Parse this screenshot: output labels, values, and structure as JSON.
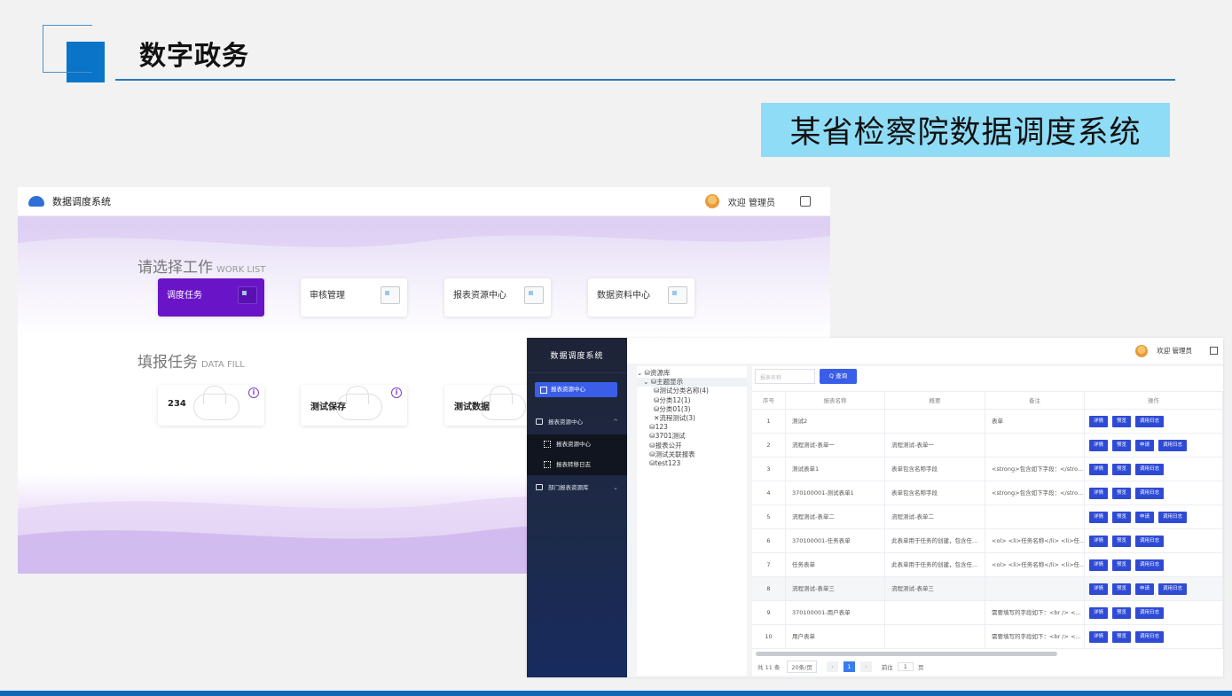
{
  "slide": {
    "title": "数字政务",
    "subtitle": "某省检察院数据调度系统"
  },
  "app1": {
    "app_name": "数据调度系统",
    "welcome": "欢迎 管理员",
    "work_list": {
      "title": "请选择工作",
      "title_en": "WORK LIST",
      "cards": [
        "调度任务",
        "审核管理",
        "报表资源中心",
        "数据资料中心"
      ]
    },
    "data_fill": {
      "title": "填报任务",
      "title_en": "DATA FILL",
      "cards": [
        "234",
        "测试保存",
        "测试数据"
      ]
    }
  },
  "app2": {
    "app_name": "数据调度系统",
    "welcome": "欢迎 管理员",
    "sidebar": {
      "search_label": "报表资源中心",
      "menu": [
        "报表资源中心",
        "部门报表资源库"
      ],
      "submenu": [
        "报表资源中心",
        "报表转移日志"
      ]
    },
    "tree": [
      "⌄ ⛁资源库",
      "   ⌄ ⛁主题显示",
      "        ⛁测试分类名称(4)",
      "        ⛁分类12(1)",
      "        ⛁分类01(3)",
      "        ✕流程测试(3)",
      "      ⛁123",
      "      ⛁3701测试",
      "      ⛁报表公开",
      "      ⛁测试关联报表",
      "      ⛁test123"
    ],
    "search": {
      "placeholder": "报表名称",
      "button": "Q 查询"
    },
    "columns": [
      "序号",
      "报表名称",
      "概要",
      "备注",
      "操作"
    ],
    "rows": [
      {
        "no": "1",
        "name": "测试2",
        "summary": "",
        "note": "表单",
        "ops": [
          "详情",
          "预览",
          "调用日志"
        ]
      },
      {
        "no": "2",
        "name": "流程测试-表单一",
        "summary": "流程测试-表单一",
        "note": "",
        "ops": [
          "详情",
          "预览",
          "申请",
          "调用日志"
        ]
      },
      {
        "no": "3",
        "name": "测试表单1",
        "summary": "表单包含名称字段",
        "note": "<strong>包含如下字段：</stro...",
        "ops": [
          "详情",
          "预览",
          "调用日志"
        ]
      },
      {
        "no": "4",
        "name": "370100001-测试表单1",
        "summary": "表单包含名称字段",
        "note": "<strong>包含如下字段：</stro...",
        "ops": [
          "详情",
          "预览",
          "调用日志"
        ]
      },
      {
        "no": "5",
        "name": "流程测试-表单二",
        "summary": "流程测试-表单二",
        "note": "",
        "ops": [
          "详情",
          "预览",
          "申请",
          "调用日志"
        ]
      },
      {
        "no": "6",
        "name": "370100001-任务表单",
        "summary": "此表单用于任务的创建，包含任...",
        "note": "<ol> <li>任务名称</li> <li>任...",
        "ops": [
          "详情",
          "预览",
          "调用日志"
        ]
      },
      {
        "no": "7",
        "name": "任务表单",
        "summary": "此表单用于任务的创建，包含任...",
        "note": "<ol> <li>任务名称</li> <li>任...",
        "ops": [
          "详情",
          "预览",
          "调用日志"
        ]
      },
      {
        "no": "8",
        "name": "流程测试-表单三",
        "summary": "流程测试-表单三",
        "note": "",
        "ops": [
          "详情",
          "预览",
          "申请",
          "调用日志"
        ]
      },
      {
        "no": "9",
        "name": "370100001-用户表单",
        "summary": "",
        "note": "需要填写的字段如下：<br /> <...",
        "ops": [
          "详情",
          "预览",
          "调用日志"
        ]
      },
      {
        "no": "10",
        "name": "用户表单",
        "summary": "",
        "note": "需要填写的字段如下：<br /> <...",
        "ops": [
          "详情",
          "预览",
          "调用日志"
        ]
      }
    ],
    "pager": {
      "total": "共 11 条",
      "page_size": "20条/页",
      "current": "1",
      "goto_label": "前往",
      "goto_value": "1",
      "page_unit": "页"
    }
  },
  "colors": {
    "accent": "#0a74c8",
    "purple": "#6a14c8",
    "button_blue": "#2f4bd6",
    "subtitle_bg": "#8fdcf7"
  }
}
